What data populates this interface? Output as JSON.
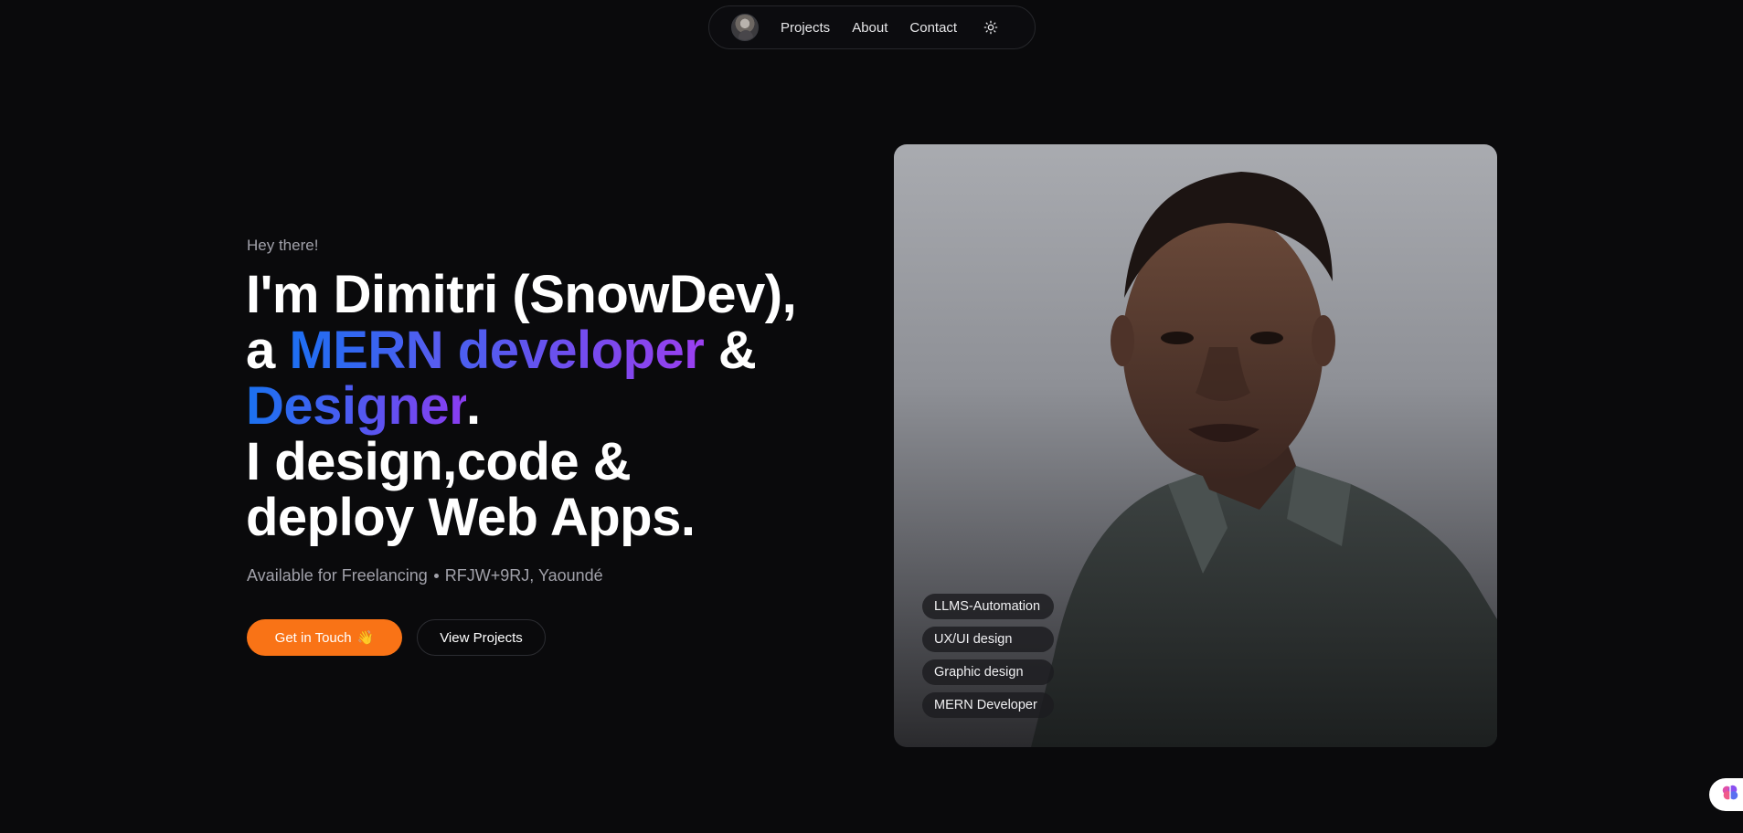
{
  "nav": {
    "items": [
      {
        "label": "Projects"
      },
      {
        "label": "About"
      },
      {
        "label": "Contact"
      }
    ],
    "theme_icon": "sun-icon",
    "avatar_icon": "avatar"
  },
  "hero": {
    "greeting": "Hey there!",
    "line1": "I'm Dimitri (SnowDev),",
    "line2_prefix": "a ",
    "line2_mern": "MERN",
    "line2_space": " ",
    "line2_developer": "developer",
    "line2_suffix": " &",
    "line3_designer": "Designer",
    "line3_period": ".",
    "line4": "I design,code &",
    "line5": "deploy Web Apps.",
    "availability": "Available for Freelancing",
    "location": "RFJW+9RJ, Yaoundé",
    "primary_button": "Get in Touch",
    "primary_button_icon": "👋",
    "secondary_button": "View Projects"
  },
  "portrait": {
    "tags": [
      {
        "label": "LLMS-Automation"
      },
      {
        "label": "UX/UI design"
      },
      {
        "label": "Graphic design"
      },
      {
        "label": "MERN Developer"
      }
    ]
  },
  "widget": {
    "icon": "brain-icon"
  },
  "colors": {
    "background": "#0a0a0c",
    "accent": "#f97316",
    "gradient_start": "#1d6ff2",
    "gradient_end": "#9b3ff0",
    "muted_text": "#a1a1aa"
  }
}
